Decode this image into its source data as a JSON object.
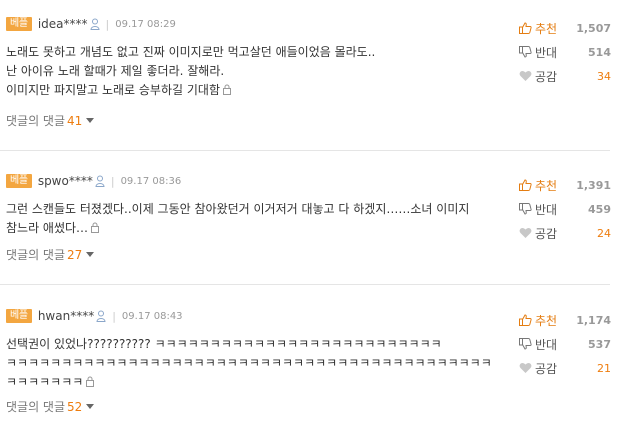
{
  "comments": [
    {
      "badge": "베플",
      "username": "idea****",
      "date": "09.17 08:29",
      "lines": [
        "노래도 못하고 개념도 없고 진짜 이미지로만 먹고살던 애들이었음 몰라도..",
        "난 아이유 노래 할때가 제일 좋더라. 잘해라.",
        "이미지만 파지말고 노래로 승부하길 기대함"
      ],
      "reply_label": "댓글의 댓글",
      "reply_count": "41",
      "recommend_label": "추천",
      "recommend_count": "1,507",
      "oppose_label": "반대",
      "oppose_count": "514",
      "like_label": "공감",
      "like_count": "34"
    },
    {
      "badge": "베플",
      "username": "spwo****",
      "date": "09.17 08:36",
      "lines": [
        "그런 스캔들도 터졌겠다..이제 그동안 참아왔던거 이거저거 대놓고 다 하겠지……소녀 이미지",
        "참느라 애썼다…"
      ],
      "reply_label": "댓글의 댓글",
      "reply_count": "27",
      "recommend_label": "추천",
      "recommend_count": "1,391",
      "oppose_label": "반대",
      "oppose_count": "459",
      "like_label": "공감",
      "like_count": "24"
    },
    {
      "badge": "베플",
      "username": "hwan****",
      "date": "09.17 08:43",
      "lines": [
        "선택권이 있었나?????????? ㅋㅋㅋㅋㅋㅋㅋㅋㅋㅋㅋㅋㅋㅋㅋㅋㅋㅋㅋㅋㅋㅋㅋㅋㅋㅋ",
        "ㅋㅋㅋㅋㅋㅋㅋㅋㅋㅋㅋㅋㅋㅋㅋㅋㅋㅋㅋㅋㅋㅋㅋㅋㅋㅋㅋㅋㅋㅋㅋㅋㅋㅋㅋㅋㅋㅋㅋㅋㅋㅋㅋㅋ",
        "ㅋㅋㅋㅋㅋㅋㅋ"
      ],
      "reply_label": "댓글의 댓글",
      "reply_count": "52",
      "recommend_label": "추천",
      "recommend_count": "1,174",
      "oppose_label": "반대",
      "oppose_count": "537",
      "like_label": "공감",
      "like_count": "21"
    }
  ],
  "colors": {
    "badge": "#f3a640",
    "accent": "#ee7d0f",
    "divider": "#e5e5e5"
  }
}
